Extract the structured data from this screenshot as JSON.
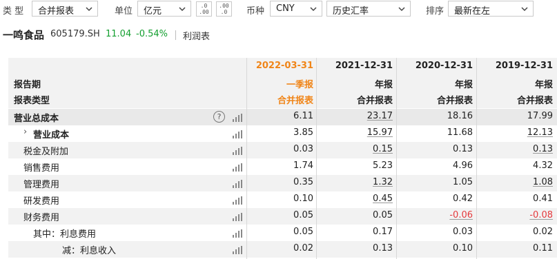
{
  "toolbar": {
    "type_label": "类 型",
    "type_value": "合并报表",
    "unit_label": "单位",
    "unit_value": "亿元",
    "dec_decrease": ".0\n←.00",
    "dec_increase": ".00\n→.0",
    "currency_label": "币种",
    "currency_value": "CNY",
    "rate_value": "历史汇率",
    "sort_label": "排序",
    "sort_value": "最新在左"
  },
  "stock": {
    "name": "一鸣食品",
    "code": "605179.SH",
    "price": "11.04",
    "change": "-0.54%",
    "report": "利润表"
  },
  "colors": {
    "up_green": "#129e2e",
    "negative_red": "#e4393c",
    "latest_orange": "#f08518"
  },
  "header": {
    "period_label": "报告期",
    "type_label": "报表类型",
    "columns": [
      {
        "date": "2022-03-31",
        "period": "一季报",
        "type": "合并报表"
      },
      {
        "date": "2021-12-31",
        "period": "年报",
        "type": "合并报表"
      },
      {
        "date": "2020-12-31",
        "period": "年报",
        "type": "合并报表"
      },
      {
        "date": "2019-12-31",
        "period": "年报",
        "type": "合并报表"
      }
    ]
  },
  "rows": [
    {
      "label": "营业总成本",
      "values": [
        "6.11",
        "23.17",
        "18.16",
        "17.99"
      ]
    },
    {
      "label": "营业成本",
      "values": [
        "3.85",
        "15.97",
        "11.68",
        "12.13"
      ]
    },
    {
      "label": "税金及附加",
      "values": [
        "0.03",
        "0.15",
        "0.13",
        "0.13"
      ]
    },
    {
      "label": "销售费用",
      "values": [
        "1.74",
        "5.23",
        "4.96",
        "4.32"
      ]
    },
    {
      "label": "管理费用",
      "values": [
        "0.35",
        "1.32",
        "1.05",
        "1.08"
      ]
    },
    {
      "label": "研发费用",
      "values": [
        "0.10",
        "0.45",
        "0.42",
        "0.41"
      ]
    },
    {
      "label": "财务费用",
      "values": [
        "0.05",
        "0.05",
        "-0.06",
        "-0.08"
      ]
    },
    {
      "label": "其中：利息费用",
      "values": [
        "0.05",
        "0.17",
        "0.03",
        "0.02"
      ]
    },
    {
      "label": "减：利息收入",
      "values": [
        "0.02",
        "0.13",
        "0.10",
        "0.11"
      ]
    }
  ],
  "icons": {
    "expand": "chevron-right-icon",
    "info": "info-circle-icon",
    "chart": "bar-chart-icon"
  }
}
